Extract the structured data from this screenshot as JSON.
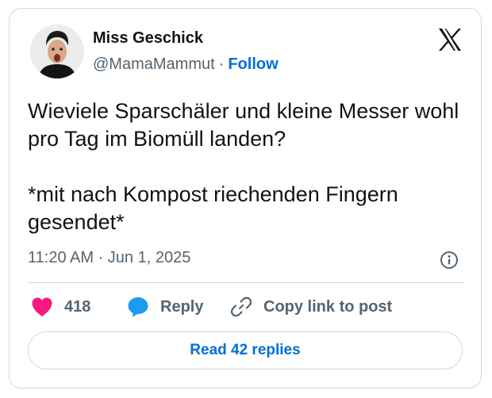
{
  "author": {
    "name": "Miss Geschick",
    "handle": "@MamaMammut",
    "separator": "·",
    "follow_label": "Follow"
  },
  "tweet": {
    "lines": [
      "Wieviele Sparschäler und kleine Messer wohl pro Tag im Biomüll landen?",
      "*mit nach Kompost riechenden Fingern gesendet*"
    ],
    "timestamp": "11:20 AM · Jun 1, 2025"
  },
  "actions": {
    "like_count": "418",
    "reply_label": "Reply",
    "copy_label": "Copy link to post"
  },
  "read_replies_label": "Read 42 replies",
  "icons": {
    "brand": "x-logo-icon",
    "info": "info-icon",
    "like": "heart-icon",
    "reply": "speech-bubble-icon",
    "copy": "link-icon"
  },
  "colors": {
    "link": "#006fd6",
    "heart": "#f91880",
    "reply_bubble": "#1d9bf0",
    "muted_text": "#536471",
    "border": "#cfd9de"
  }
}
